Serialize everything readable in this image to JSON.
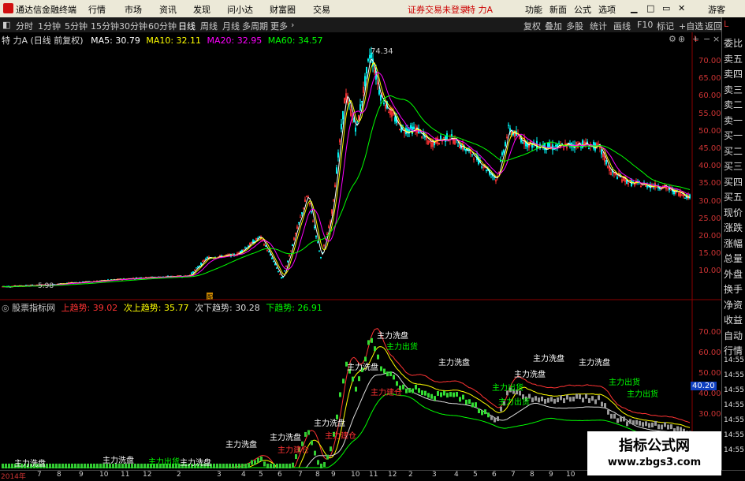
{
  "topbar": {
    "app_title": "通达信金融终端",
    "menus": [
      "行情",
      "市场",
      "资讯",
      "发现",
      "问小达",
      "财富圈",
      "交易"
    ],
    "login_status": "证券交易未登录",
    "stock_name": "特 力A",
    "right_menus": [
      "功能",
      "新面",
      "公式",
      "选项"
    ],
    "guest": "游客"
  },
  "toolbar": {
    "periods": [
      "分时",
      "1分钟",
      "5分钟",
      "15分钟",
      "30分钟",
      "60分钟",
      "日线",
      "周线",
      "月线",
      "多周期",
      "更多"
    ],
    "active_period": "日线",
    "right_tools": [
      "复权",
      "叠加",
      "多股",
      "统计",
      "画线",
      "F10",
      "标记",
      "+自选",
      "返回"
    ]
  },
  "main_legend": {
    "name": "特 力A (日线 前复权)",
    "ma5": "MA5: 30.79",
    "ma10": "MA10: 32.11",
    "ma20": "MA20: 32.95",
    "ma60": "MA60: 34.57"
  },
  "main_axis": [
    "70.00",
    "65.00",
    "60.00",
    "55.00",
    "50.00",
    "45.00",
    "40.00",
    "35.00",
    "30.00",
    "25.00",
    "20.00",
    "15.00",
    "10.00"
  ],
  "main_markers": {
    "high": "74.34",
    "low": "5.98",
    "corner": "L",
    "tag": "配"
  },
  "sub_legend": {
    "name": "股票指标网",
    "up": "上趋势: 39.02",
    "next_up": "次上趋势: 35.77",
    "next_down": "次下趋势: 30.28",
    "down": "下趋势: 26.91"
  },
  "sub_axis": [
    "70.00",
    "60.00",
    "50.00",
    "40.00",
    "30.00"
  ],
  "sub_current": "40.20",
  "sub_annotations": {
    "wash": "主力洗盘",
    "ship": "主力出货",
    "buy": "主力建仓"
  },
  "right_panel": {
    "items": [
      "委比",
      "卖五",
      "卖四",
      "卖三",
      "卖二",
      "卖一",
      "买一",
      "买二",
      "买三",
      "买四",
      "买五",
      "现价",
      "涨跌",
      "涨幅",
      "总量",
      "外盘",
      "换手",
      "净资",
      "收益",
      "自动",
      "行情"
    ],
    "times": [
      "14:55",
      "14:55",
      "14:55",
      "14:55",
      "14:55",
      "14:55",
      "14:55"
    ]
  },
  "bottom_axis": [
    "2014年",
    "7",
    "8",
    "9",
    "10",
    "11",
    "12",
    "2",
    "3",
    "4",
    "5",
    "6",
    "7",
    "8",
    "9",
    "10",
    "11",
    "12",
    "2",
    "3",
    "4",
    "5",
    "6",
    "7",
    "8",
    "9",
    "10"
  ],
  "watermark": {
    "title": "指标公式网",
    "url": "www.zbgs3.com"
  },
  "colors": {
    "ma5": "#ffffff",
    "ma10": "#ffff00",
    "ma20": "#ff00ff",
    "ma60": "#00ff00",
    "up_candle": "#ff3333",
    "down_candle": "#00ffff",
    "axis": "#cc3333"
  }
}
